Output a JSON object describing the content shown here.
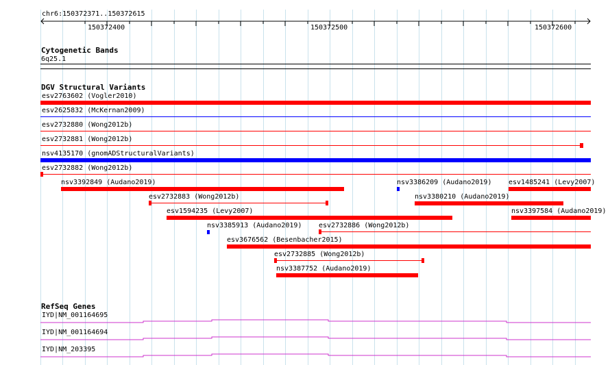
{
  "ruler": {
    "location": "chr6:150372371..150372615",
    "ticks": [
      "150372400",
      "150372500",
      "150372600"
    ]
  },
  "cytoband_track": {
    "title": "Cytogenetic Bands",
    "band": "6q25.1"
  },
  "dgv_track": {
    "title": "DGV Structural Variants",
    "features": [
      {
        "label": "esv2763602 (Vogler2010)",
        "color": "#ff0000",
        "style": "thick"
      },
      {
        "label": "esv2625832 (McKernan2009)",
        "color": "#0000ff",
        "style": "thin"
      },
      {
        "label": "esv2732880 (Wong2012b)",
        "color": "#ff0000",
        "style": "thin"
      },
      {
        "label": "esv2732881 (Wong2012b)",
        "color": "#ff0000",
        "style": "thin-ticked"
      },
      {
        "label": "nsv4135170 (gnomADStructuralVariants)",
        "color": "#0000ff",
        "style": "thick"
      },
      {
        "label": "esv2732882 (Wong2012b)",
        "color": "#ff0000",
        "style": "thin-ticked"
      },
      {
        "label": "nsv3392849 (Audano2019)",
        "color": "#ff0000",
        "style": "thick"
      },
      {
        "label": "nsv3386209 (Audano2019)",
        "color": "#0000ff",
        "style": "box"
      },
      {
        "label": "esv1485241 (Levy2007)",
        "color": "#ff0000",
        "style": "thick"
      },
      {
        "label": "esv2732883 (Wong2012b)",
        "color": "#ff0000",
        "style": "thin-ticked"
      },
      {
        "label": "nsv3380210 (Audano2019)",
        "color": "#ff0000",
        "style": "thick"
      },
      {
        "label": "esv1594235 (Levy2007)",
        "color": "#ff0000",
        "style": "thick"
      },
      {
        "label": "nsv3397584 (Audano2019)",
        "color": "#ff0000",
        "style": "thick"
      },
      {
        "label": "nsv3385913 (Audano2019)",
        "color": "#0000ff",
        "style": "box"
      },
      {
        "label": "esv2732886 (Wong2012b)",
        "color": "#ff0000",
        "style": "thin-ticked"
      },
      {
        "label": "esv3676562 (Besenbacher2015)",
        "color": "#ff0000",
        "style": "thick"
      },
      {
        "label": "esv2732885 (Wong2012b)",
        "color": "#ff0000",
        "style": "thin-ticked"
      },
      {
        "label": "nsv3387752 (Audano2019)",
        "color": "#ff0000",
        "style": "thick"
      }
    ]
  },
  "refseq_track": {
    "title": "RefSeq Genes",
    "color": "#cc33cc",
    "genes": [
      {
        "label": "IYD|NM_001164695"
      },
      {
        "label": "IYD|NM_001164694"
      },
      {
        "label": "IYD|NM_203395"
      }
    ]
  }
}
